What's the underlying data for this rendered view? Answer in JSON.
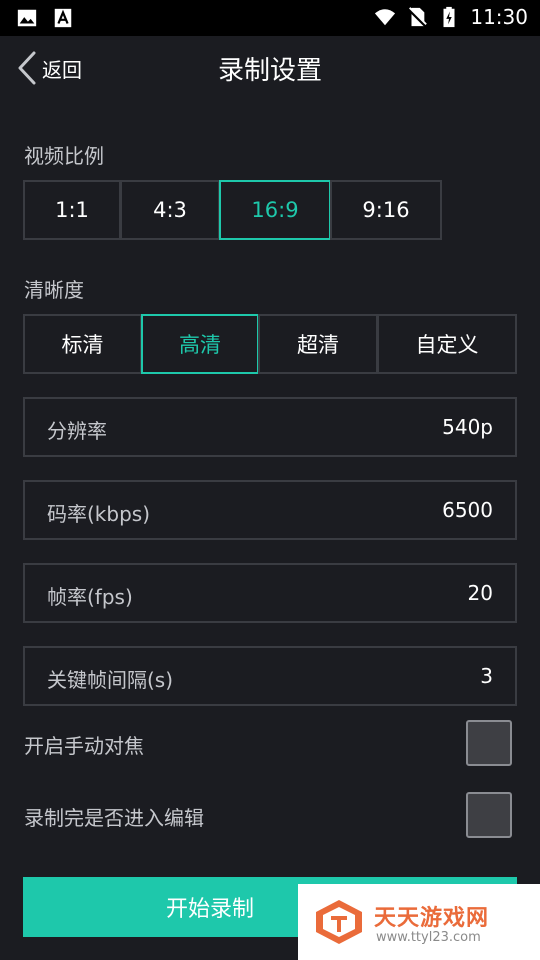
{
  "status_bar": {
    "time": "11:30",
    "icons": [
      "image-icon",
      "font-a-icon",
      "wifi-icon",
      "no-sim-icon",
      "battery-charging-icon"
    ]
  },
  "header": {
    "back_label": "返回",
    "title": "录制设置"
  },
  "aspect_ratio": {
    "label": "视频比例",
    "options": [
      "1:1",
      "4:3",
      "16:9",
      "9:16"
    ],
    "selected": "16:9"
  },
  "clarity": {
    "label": "清晰度",
    "options": [
      "标清",
      "高清",
      "超清",
      "自定义"
    ],
    "selected": "高清"
  },
  "fields": [
    {
      "label": "分辨率",
      "value": "540p"
    },
    {
      "label": "码率(kbps)",
      "value": "6500"
    },
    {
      "label": "帧率(fps)",
      "value": "20"
    },
    {
      "label": "关键帧间隔(s)",
      "value": "3"
    }
  ],
  "toggles": [
    {
      "label": "开启手动对焦",
      "checked": false
    },
    {
      "label": "录制完是否进入编辑",
      "checked": false
    }
  ],
  "start_button": {
    "label": "开始录制"
  },
  "watermark": {
    "title": "天天游戏网",
    "url": "www.ttyl23.com"
  },
  "colors": {
    "accent": "#1ec8ab",
    "background": "#1b1c21",
    "border": "#3a3c42"
  }
}
